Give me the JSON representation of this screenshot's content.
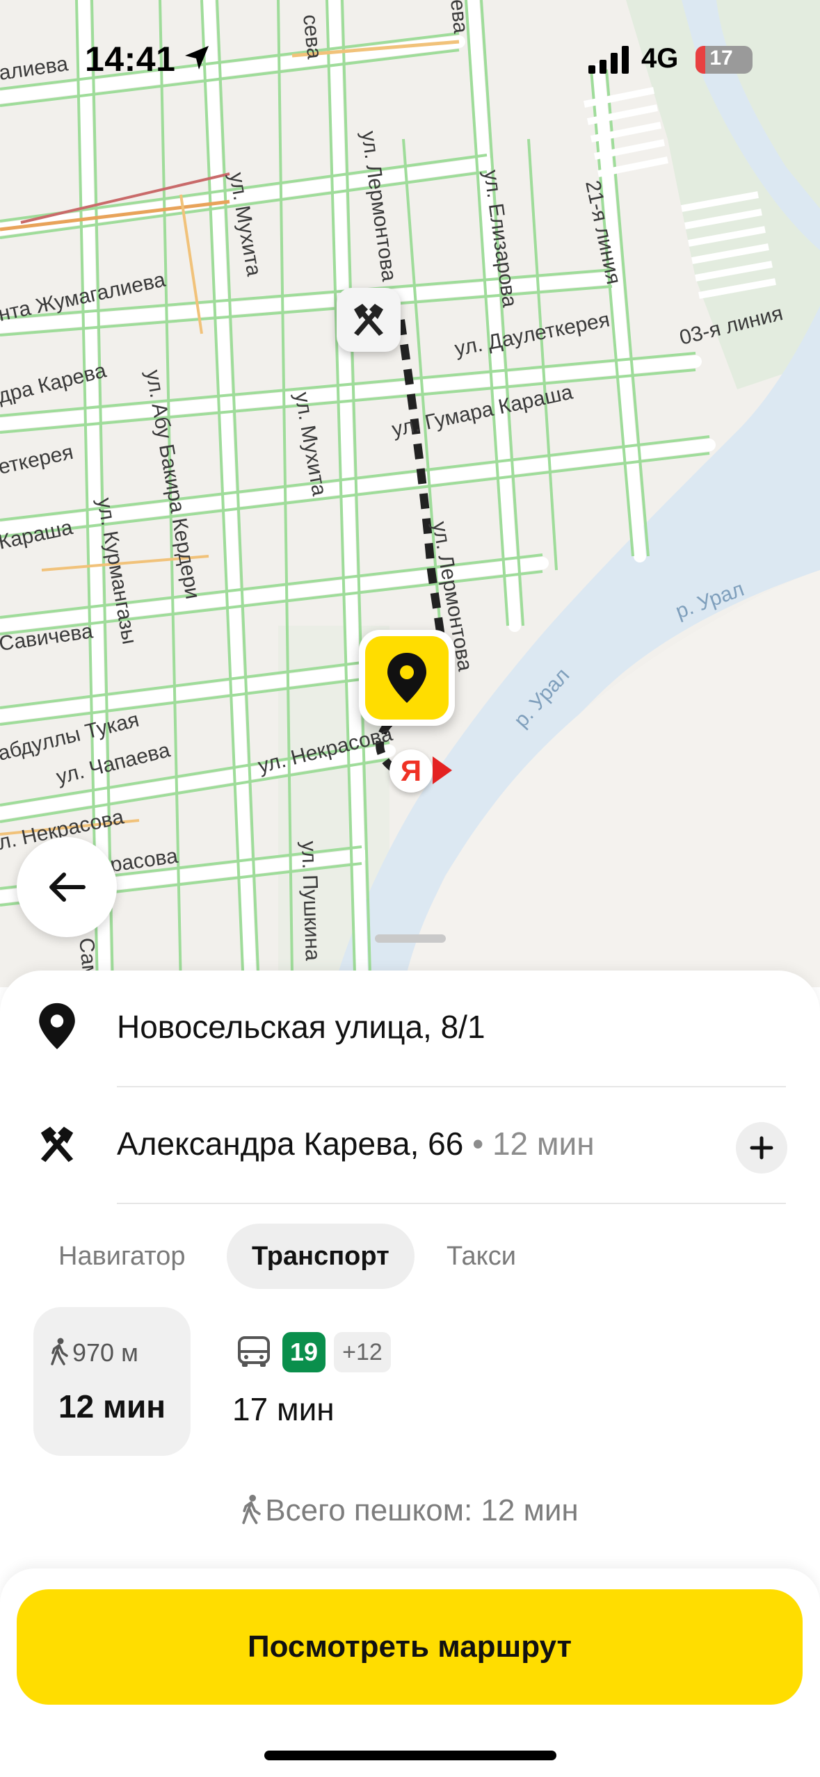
{
  "status_bar": {
    "time": "14:41",
    "network": "4G",
    "battery": "17",
    "battery_level": 0.17
  },
  "map": {
    "streets": [
      "алиева",
      "сева",
      "ева",
      "ул. Лермонтова",
      "ул. Елизарова",
      "21-я линия",
      "ул. Мухита",
      "нта Жумагалиева",
      "ул. Даулеткерея",
      "03-я линия",
      "дра Карева",
      "ул. Гумара Караша",
      "еткерея",
      "ул. Абу Бакира Кердери",
      "ул. Мухита",
      "Караша",
      "ул. Лермонтова",
      "ул. Курмангазы",
      "Савичева",
      "абдуллы Тукая",
      "ул. Чапаева",
      "ул. Некрасова",
      "л. Некрасова",
      "расова",
      "ул. Пушкина",
      "Сам",
      "Курмангазы"
    ],
    "river_labels": [
      "р. Урал",
      "р. Урал"
    ],
    "dest_marker_label": "Я"
  },
  "sheet": {
    "origin": "Новосельская улица, 8/1",
    "destination": "Александра Карева, 66",
    "destination_eta": " • 12 мин",
    "tabs": [
      {
        "label": "Навигатор"
      },
      {
        "label": "Транспорт"
      },
      {
        "label": "Такси"
      }
    ],
    "active_tab": "Транспорт",
    "walk": {
      "distance": "970 м",
      "time": "12 мин"
    },
    "bus": {
      "route": "19",
      "more": "+12",
      "time": "17 мин"
    },
    "total_walk": "Всего пешком: 12 мин",
    "cta": "Посмотреть маршрут"
  },
  "colors": {
    "accent": "#ffdd00",
    "route_badge": "#0a8f4c",
    "battery_low": "#e84040",
    "river": "#dfe9f2"
  },
  "icons": [
    "location-arrow-icon",
    "signal-icon",
    "battery-icon",
    "tools-icon",
    "pin-icon",
    "yandex-logo-icon",
    "back-arrow-icon",
    "plus-icon",
    "walk-icon",
    "bus-icon"
  ]
}
